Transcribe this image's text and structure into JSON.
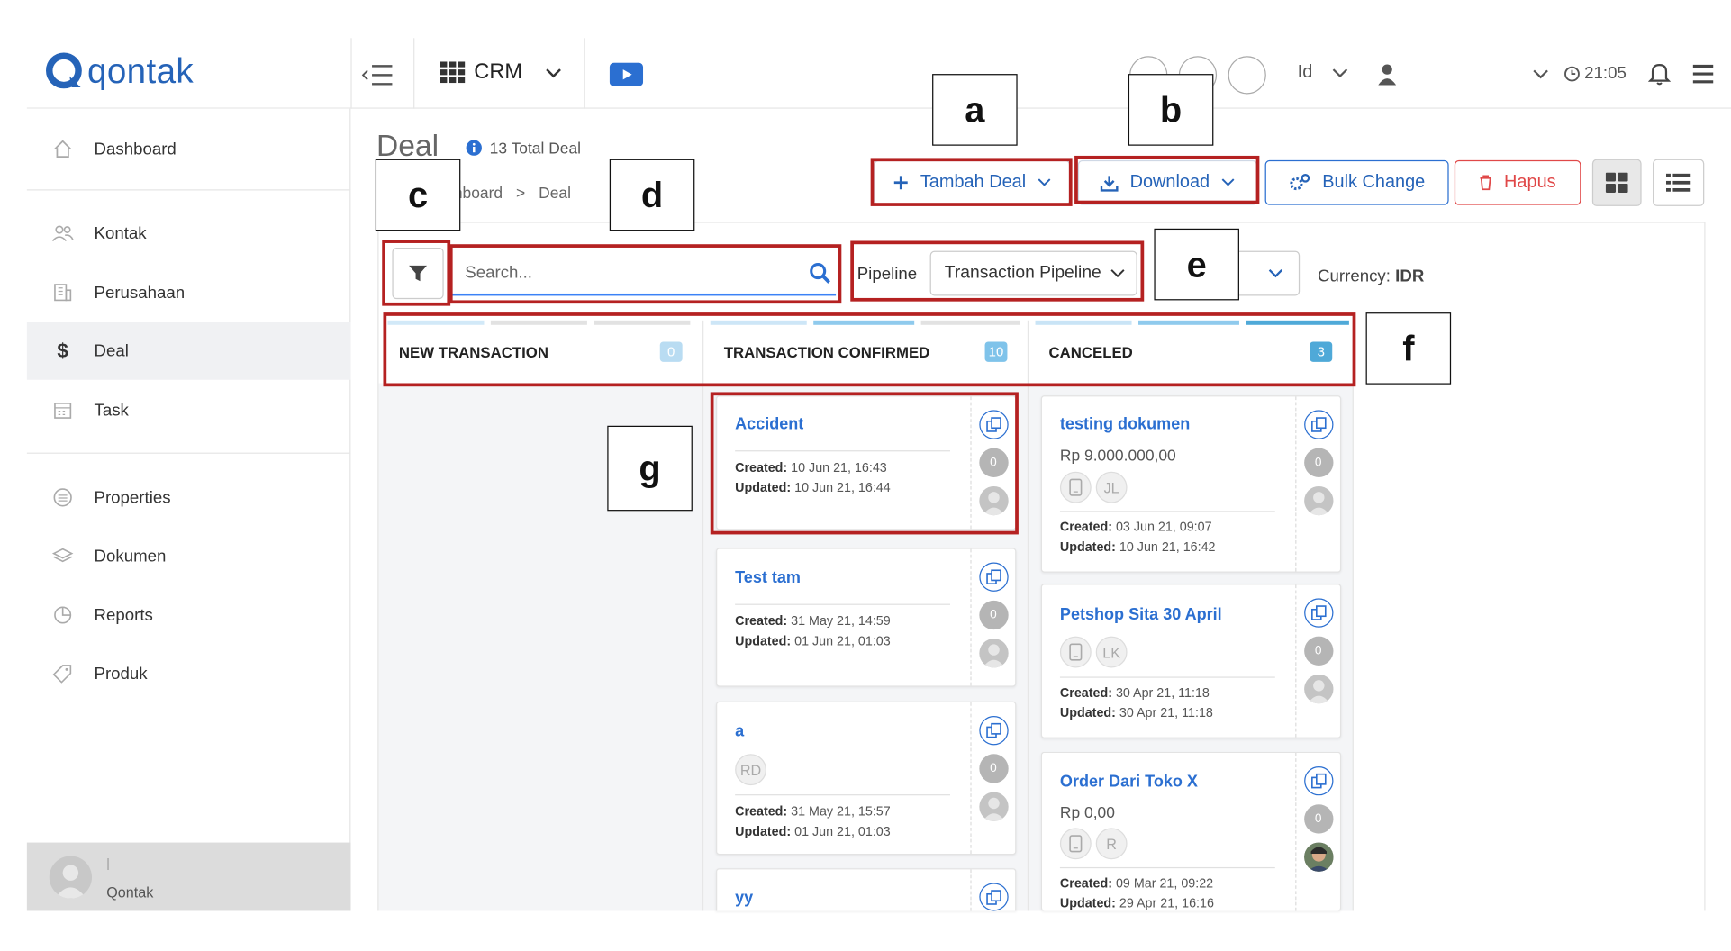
{
  "app": {
    "logo": "qontak",
    "product_menu": "CRM",
    "language": "Id",
    "time": "21:05"
  },
  "sidebar": {
    "items": [
      {
        "label": "Dashboard",
        "icon": "home-icon"
      },
      {
        "label": "Kontak",
        "icon": "contacts-icon"
      },
      {
        "label": "Perusahaan",
        "icon": "building-icon"
      },
      {
        "label": "Deal",
        "icon": "dollar-icon",
        "active": true
      },
      {
        "label": "Task",
        "icon": "calendar-icon"
      },
      {
        "label": "Properties",
        "icon": "list-icon"
      },
      {
        "label": "Dokumen",
        "icon": "layers-icon"
      },
      {
        "label": "Reports",
        "icon": "pie-chart-icon"
      },
      {
        "label": "Produk",
        "icon": "tag-icon"
      }
    ],
    "user": {
      "divider": "|",
      "name": "Qontak"
    }
  },
  "page": {
    "title": "Deal",
    "total": "13 Total Deal",
    "breadcrumb": [
      "hboard",
      ">",
      "Deal"
    ]
  },
  "toolbar": {
    "add": "Tambah Deal",
    "download": "Download",
    "bulk": "Bulk Change",
    "delete": "Hapus"
  },
  "filters": {
    "search_placeholder": "Search...",
    "pipeline_label": "Pipeline",
    "pipeline_value": "Transaction Pipeline",
    "currency_label": "Currency:",
    "currency_value": "IDR"
  },
  "annotations": [
    "a",
    "b",
    "c",
    "d",
    "e",
    "f",
    "g"
  ],
  "columns": [
    {
      "name": "NEW TRANSACTION",
      "count": "0",
      "badge_color": "#b9dcf2"
    },
    {
      "name": "TRANSACTION CONFIRMED",
      "count": "10",
      "badge_color": "#7fc3ea"
    },
    {
      "name": "CANCELED",
      "count": "3",
      "badge_color": "#4fa9d8"
    }
  ],
  "cards": {
    "confirmed": [
      {
        "title": "Accident",
        "created_label": "Created:",
        "created": "10 Jun 21, 16:43",
        "updated_label": "Updated:",
        "updated": "10 Jun 21, 16:44",
        "count": "0"
      },
      {
        "title": "Test tam",
        "created_label": "Created:",
        "created": "31 May 21, 14:59",
        "updated_label": "Updated:",
        "updated": "01 Jun 21, 01:03",
        "count": "0"
      },
      {
        "title": "a",
        "chip": "RD",
        "created_label": "Created:",
        "created": "31 May 21, 15:57",
        "updated_label": "Updated:",
        "updated": "01 Jun 21, 01:03",
        "count": "0"
      },
      {
        "title": "yy"
      }
    ],
    "canceled": [
      {
        "title": "testing dokumen",
        "amount": "Rp 9.000.000,00",
        "chip": "JL",
        "created_label": "Created:",
        "created": "03 Jun 21, 09:07",
        "updated_label": "Updated:",
        "updated": "10 Jun 21, 16:42",
        "count": "0"
      },
      {
        "title": "Petshop Sita 30 April",
        "chip": "LK",
        "created_label": "Created:",
        "created": "30 Apr 21, 11:18",
        "updated_label": "Updated:",
        "updated": "30 Apr 21, 11:18",
        "count": "0"
      },
      {
        "title": "Order Dari Toko X",
        "amount": "Rp 0,00",
        "chip": "R",
        "created_label": "Created:",
        "created": "09 Mar 21, 09:22",
        "updated_label": "Updated:",
        "updated": "29 Apr 21, 16:16",
        "count": "0"
      }
    ]
  },
  "colors": {
    "brand": "#2563b8",
    "link": "#2b6fd1",
    "annotation_box": "#b52121",
    "danger": "#e04848"
  }
}
